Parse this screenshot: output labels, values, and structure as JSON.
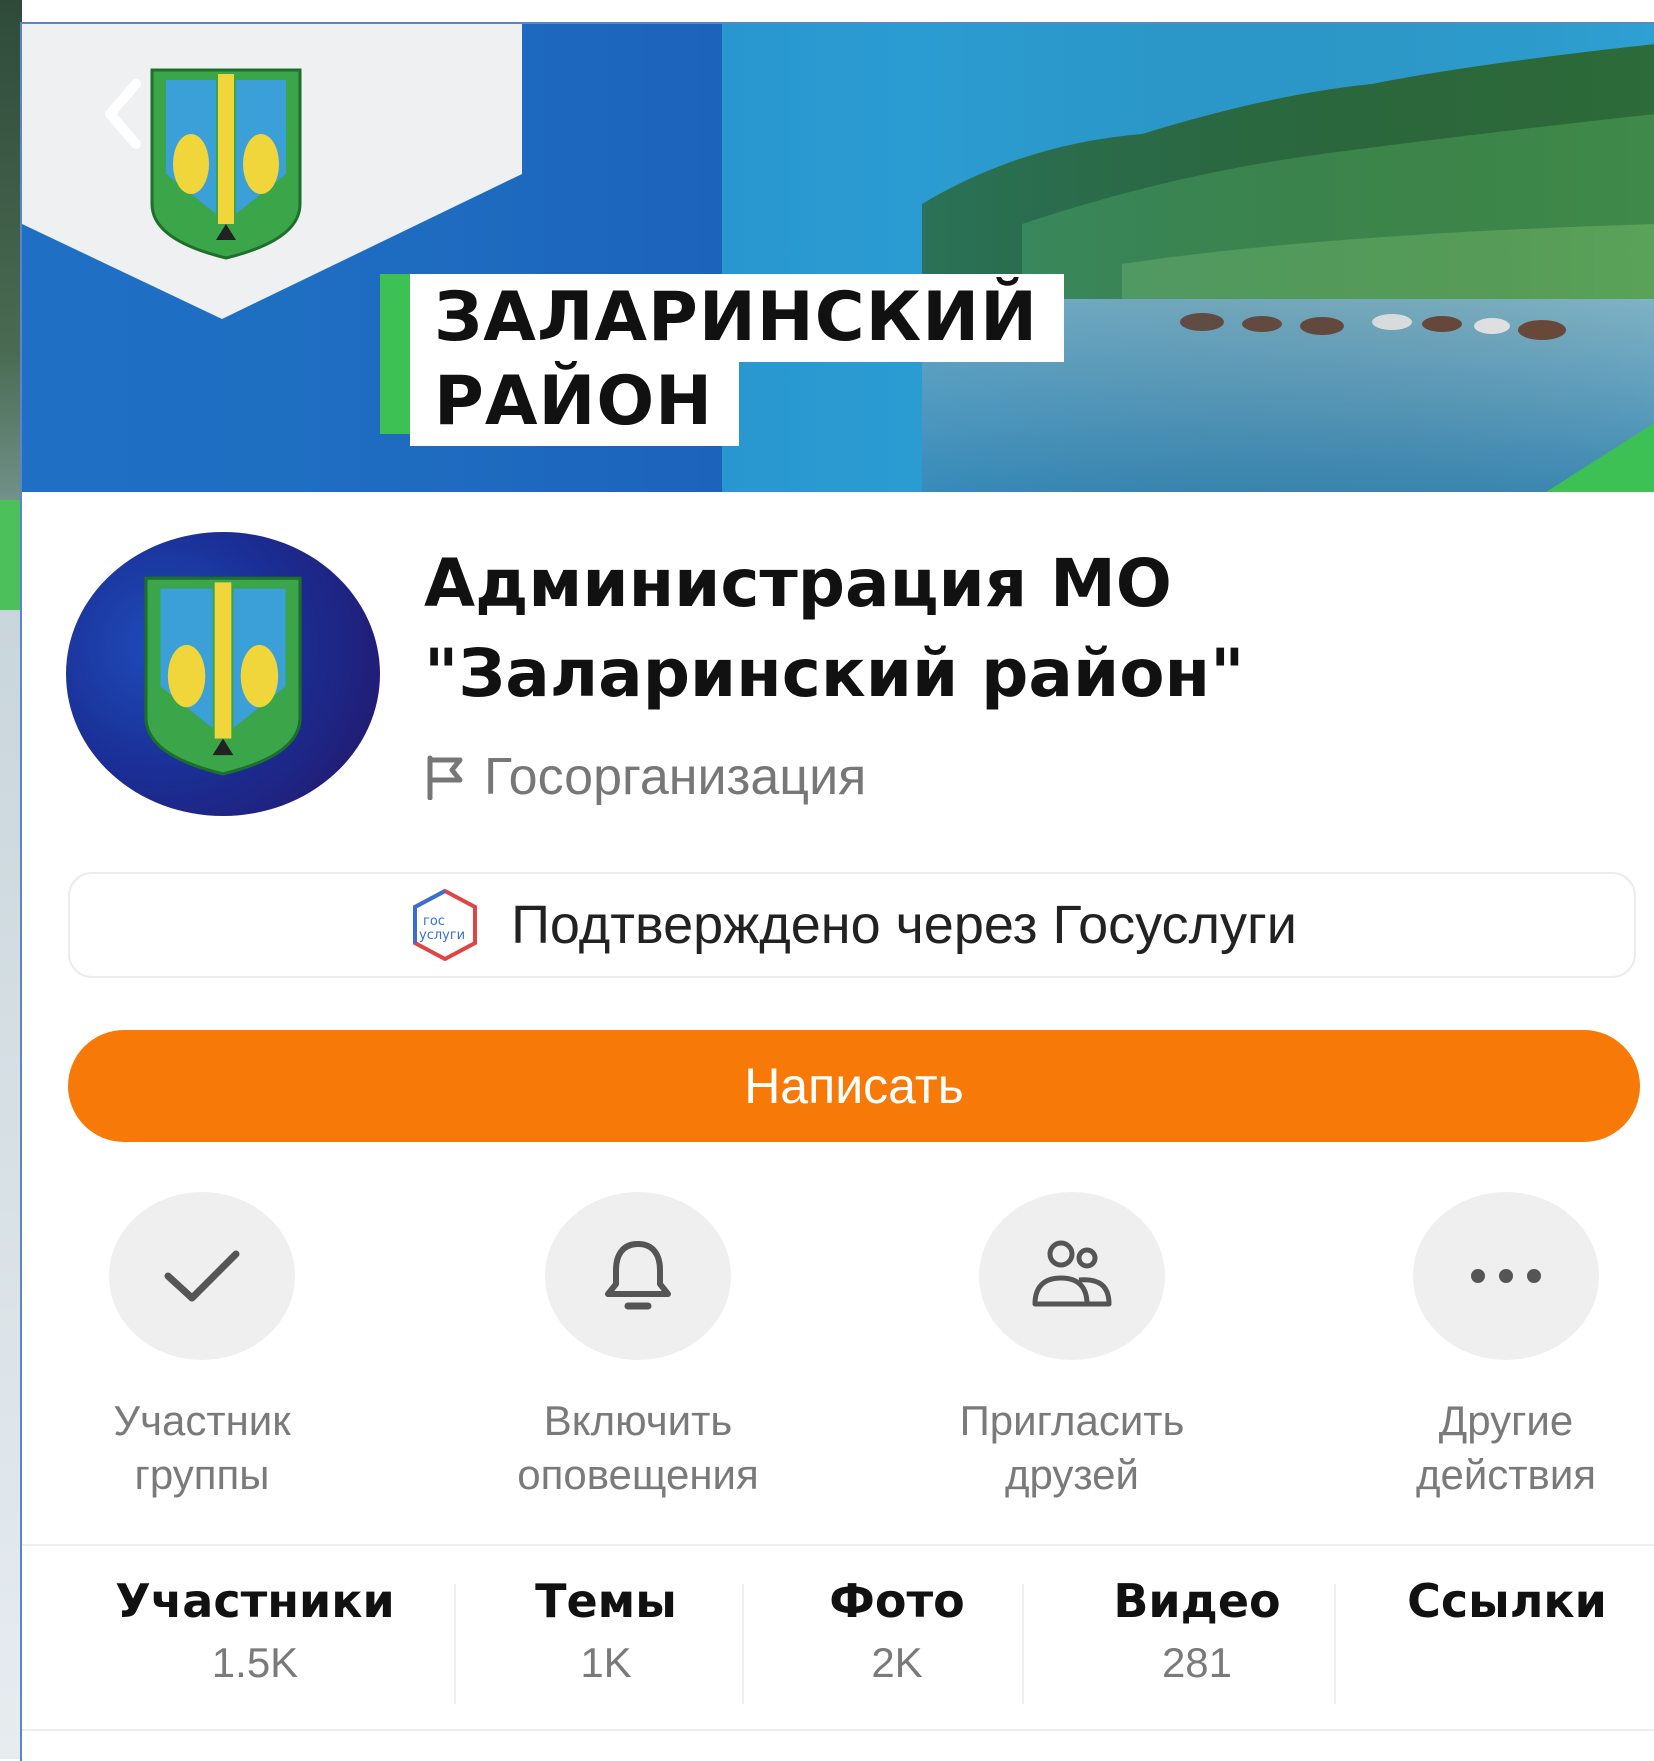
{
  "banner": {
    "title_line1": "ЗАЛАРИНСКИЙ",
    "title_line2": "РАЙОН"
  },
  "profile": {
    "name": "Администрация МО \"Заларинский район\"",
    "type": "Госорганизация"
  },
  "verified": {
    "icon_text_top": "гос",
    "icon_text_bottom": "услуги",
    "label": "Подтверждено через Госуслуги"
  },
  "write_button": {
    "label": "Написать"
  },
  "actions": [
    {
      "label": "Участник\nгруппы",
      "icon": "check-icon"
    },
    {
      "label": "Включить\nоповещения",
      "icon": "bell-icon"
    },
    {
      "label": "Пригласить\nдрузей",
      "icon": "people-icon"
    },
    {
      "label": "Другие\nдействия",
      "icon": "more-icon"
    }
  ],
  "stats": [
    {
      "name": "Участники",
      "value": "1.5K"
    },
    {
      "name": "Темы",
      "value": "1K"
    },
    {
      "name": "Фото",
      "value": "2K"
    },
    {
      "name": "Видео",
      "value": "281"
    },
    {
      "name": "Ссылки",
      "value": ""
    }
  ],
  "colors": {
    "accent_orange": "#f77a08",
    "green": "#3ec154",
    "banner_blue": "#1c58b6"
  }
}
